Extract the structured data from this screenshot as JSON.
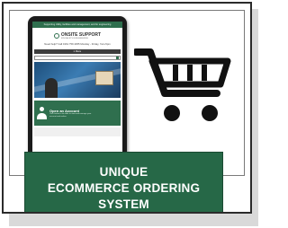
{
  "tablet": {
    "topbar_text": "Supporting Utility, facilities and management, and for engineering",
    "logo_name": "ONSITE SUPPORT",
    "logo_sub": "SPECIALISTS IN ENGINEERING",
    "phone_text": "Need help? Call 0161 759 4455 Monday - Friday, 7am-5pm",
    "nav_text": "≡ Menu",
    "account_title": "Open an Account",
    "account_sub": "Click below to be able to view and manage your account and orders"
  },
  "label": {
    "line1": "UNIQUE",
    "line2": "ECOMMERCE ORDERING",
    "line3": "SYSTEM"
  },
  "icons": {
    "cart": "shopping-cart-icon",
    "account": "user-account-icon"
  },
  "colors": {
    "brand_green": "#266847",
    "tablet_frame": "#1b1b1b",
    "cart_black": "#111111"
  }
}
